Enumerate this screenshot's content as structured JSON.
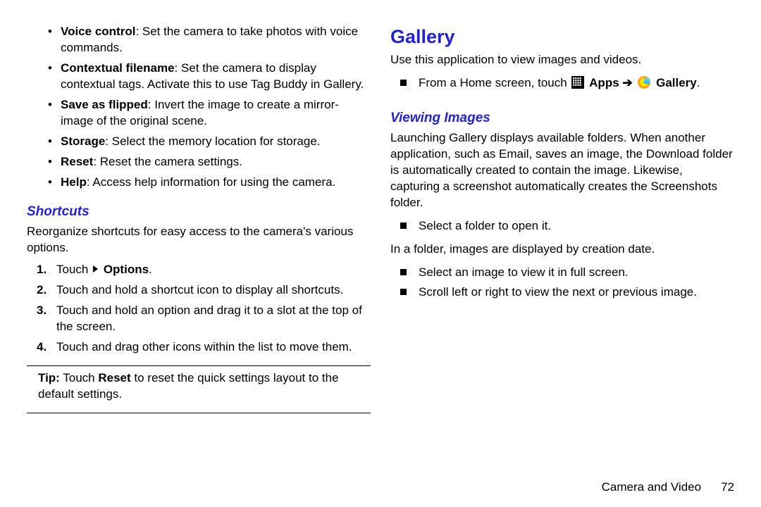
{
  "left": {
    "bullets": [
      {
        "term": "Voice control",
        "desc": ": Set the camera to take photos with voice commands."
      },
      {
        "term": "Contextual filename",
        "desc": ": Set the camera to display contextual tags. Activate this to use Tag Buddy in Gallery."
      },
      {
        "term": "Save as flipped",
        "desc": ": Invert the image to create a mirror-image of the original scene."
      },
      {
        "term": "Storage",
        "desc": ": Select the memory location for storage."
      },
      {
        "term": "Reset",
        "desc": ": Reset the camera settings."
      },
      {
        "term": "Help",
        "desc": ": Access help information for using the camera."
      }
    ],
    "shortcuts_h": "Shortcuts",
    "shortcuts_intro": "Reorganize shortcuts for easy access to the camera's various options.",
    "steps": [
      {
        "n": "1.",
        "pre": "Touch ",
        "bold": "Options",
        "post": "."
      },
      {
        "n": "2.",
        "pre": "Touch and hold a shortcut icon to display all shortcuts.",
        "bold": "",
        "post": ""
      },
      {
        "n": "3.",
        "pre": "Touch and hold an option and drag it to a slot at the top of the screen.",
        "bold": "",
        "post": ""
      },
      {
        "n": "4.",
        "pre": "Touch and drag other icons within the list to move them.",
        "bold": "",
        "post": ""
      }
    ],
    "tip_label": "Tip:",
    "tip_pre": " Touch ",
    "tip_bold": "Reset",
    "tip_post": " to reset the quick settings layout to the default settings."
  },
  "right": {
    "gallery_h": "Gallery",
    "gallery_intro": "Use this application to view images and videos.",
    "from_pre": "From a Home screen, touch ",
    "apps_label": "Apps",
    "arrow": " ➔ ",
    "gallery_label": "Gallery",
    "period": ".",
    "viewing_h": "Viewing Images",
    "viewing_p": "Launching Gallery displays available folders. When another application, such as Email, saves an image, the Download folder is automatically created to contain the image. Likewise, capturing a screenshot automatically creates the Screenshots folder.",
    "sq1": "Select a folder to open it.",
    "folder_p": "In a folder, images are displayed by creation date.",
    "sq2": "Select an image to view it in full screen.",
    "sq3": "Scroll left or right to view the next or previous image.",
    "footer_section": "Camera and Video",
    "footer_page": "72"
  }
}
